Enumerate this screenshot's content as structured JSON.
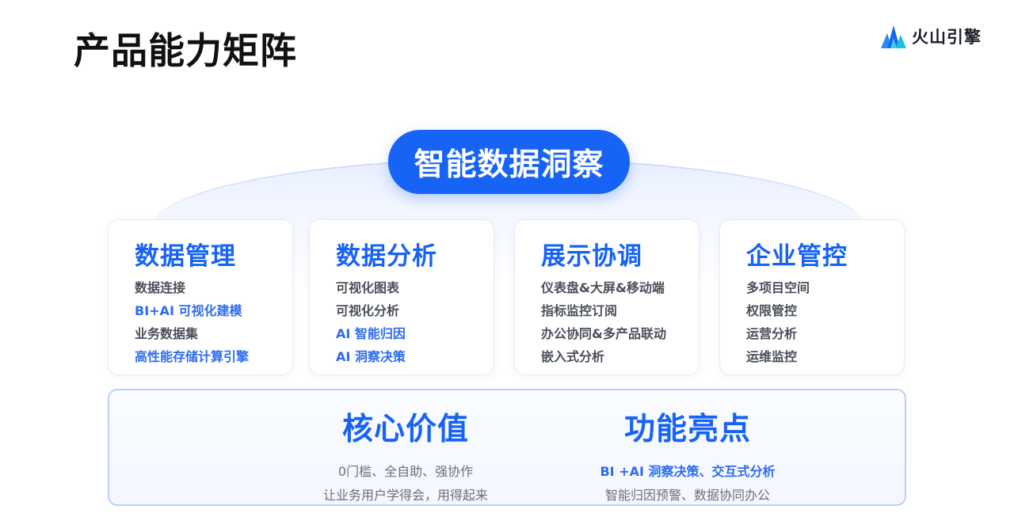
{
  "header": {
    "title": "产品能力矩阵",
    "logo_text": "火山引擎"
  },
  "center_pill": "智能数据洞察",
  "cards": [
    {
      "title": "数据管理",
      "items": [
        {
          "text": "数据连接",
          "highlight": false
        },
        {
          "text": "BI+AI 可视化建模",
          "highlight": true
        },
        {
          "text": "业务数据集",
          "highlight": false
        },
        {
          "text": "高性能存储计算引擎",
          "highlight": true
        }
      ]
    },
    {
      "title": "数据分析",
      "items": [
        {
          "text": "可视化图表",
          "highlight": false
        },
        {
          "text": "可视化分析",
          "highlight": false
        },
        {
          "text": "AI 智能归因",
          "highlight": true
        },
        {
          "text": "AI 洞察决策",
          "highlight": true
        }
      ]
    },
    {
      "title": "展示协调",
      "items": [
        {
          "text": "仪表盘&大屏&移动端",
          "highlight": false
        },
        {
          "text": "指标监控订阅",
          "highlight": false
        },
        {
          "text": "办公协同&多产品联动",
          "highlight": false
        },
        {
          "text": "嵌入式分析",
          "highlight": false
        }
      ]
    },
    {
      "title": "企业管控",
      "items": [
        {
          "text": "多项目空间",
          "highlight": false
        },
        {
          "text": "权限管控",
          "highlight": false
        },
        {
          "text": "运营分析",
          "highlight": false
        },
        {
          "text": "运维监控",
          "highlight": false
        }
      ]
    }
  ],
  "bottom": {
    "core_value": {
      "title": "核心价值",
      "lines": [
        "0门槛、全自助、强协作",
        "让业务用户学得会，用得起来"
      ]
    },
    "highlights": {
      "title": "功能亮点",
      "lines": [
        "BI +AI 洞察决策、交互式分析",
        "智能归因预警、数据协同办公"
      ]
    }
  },
  "colors": {
    "accent": "#1763f5",
    "highlight_text": "#2d6cf0",
    "body_text": "#4a4f5a"
  }
}
